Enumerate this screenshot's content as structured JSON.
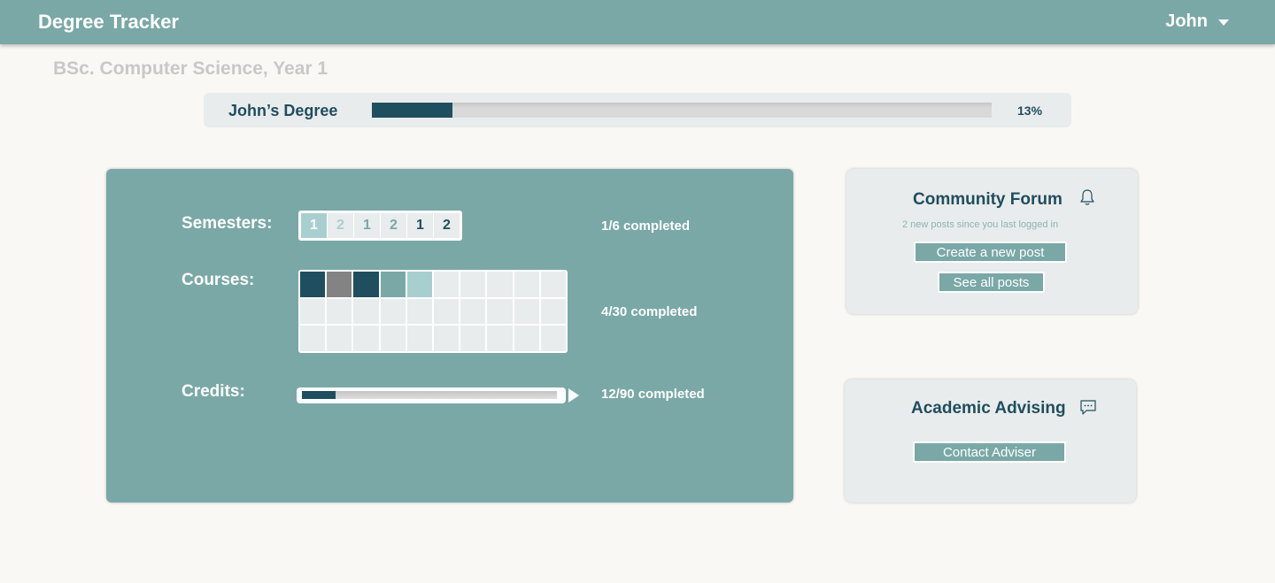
{
  "header": {
    "app_title": "Degree Tracker",
    "user_name": "John"
  },
  "program": {
    "title": "BSc. Computer Science, Year 1"
  },
  "degree_progress": {
    "label": "John’s Degree",
    "percent_label": "13%",
    "progress": 0.13
  },
  "semesters": {
    "label": "Semesters:",
    "status": "1/6 completed",
    "cells": [
      {
        "number": "1",
        "bg": "#a8cfd0",
        "color": "#ffffff"
      },
      {
        "number": "2",
        "bg": "#e8ecec",
        "color": "#a8cfd0"
      },
      {
        "number": "1",
        "bg": "#e8ecec",
        "color": "#79a8a7"
      },
      {
        "number": "2",
        "bg": "#e8ecec",
        "color": "#79a8a7"
      },
      {
        "number": "1",
        "bg": "#e8ecec",
        "color": "#1f4e5f"
      },
      {
        "number": "2",
        "bg": "#e8ecec",
        "color": "#1f4e5f"
      }
    ]
  },
  "courses": {
    "label": "Courses:",
    "status": "4/30 completed",
    "total": 30,
    "filled_colors": [
      "#1f4e5f",
      "#838383",
      "#1f4e5f",
      "#79a8a7",
      "#a8cfd0"
    ],
    "empty_color": "#e8ecec"
  },
  "credits": {
    "label": "Credits:",
    "status": "12/90 completed",
    "progress": 0.133
  },
  "forum": {
    "title": "Community Forum",
    "subtitle": "2 new posts since you last logged in",
    "create_label": "Create a new post",
    "see_all_label": "See all posts"
  },
  "advising": {
    "title": "Academic Advising",
    "contact_label": "Contact Adviser"
  },
  "colors": {
    "accent": "#79a8a7",
    "dark": "#1f4e5f",
    "light_accent": "#a8cfd0",
    "background": "#f9f8f5"
  }
}
